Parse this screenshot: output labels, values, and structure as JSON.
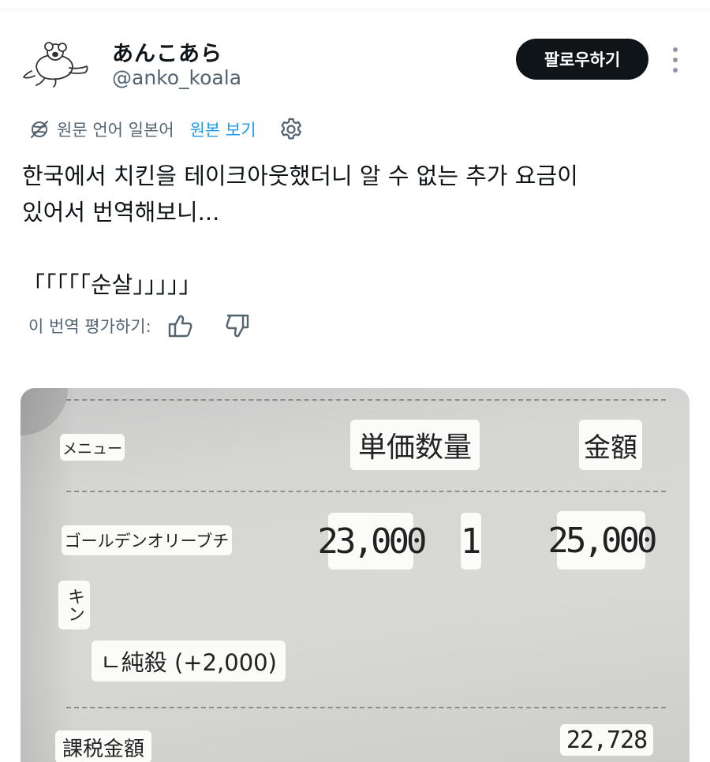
{
  "user": {
    "display_name": "あんこあら",
    "handle": "@anko_koala",
    "follow_label": "팔로우하기"
  },
  "translation": {
    "original_language": "원문 언어 일본어",
    "show_original": "원본 보기"
  },
  "tweet": {
    "lines": [
      "한국에서 치킨을 테이크아웃했더니 알 수 없는 추가 요금이",
      "있어서 번역해보니...",
      "「「「「「순살」」」」」"
    ]
  },
  "rate": {
    "label": "이 번역 평가하기:"
  },
  "receipt": {
    "menu_header": "メニュー",
    "unit_qty_header": "単価数量",
    "amount_header": "金額",
    "item_name": "ゴールデンオリーブチ",
    "item_name_cont": "キン",
    "unit_price": "23,000",
    "quantity": "1",
    "amount": "25,000",
    "option": "ㄴ純殺 (+2,000)",
    "taxable_label": "課税金額",
    "taxable_amount": "22,728"
  },
  "icons": {
    "avatar": "koala-avatar",
    "more": "more-vertical-icon",
    "globe": "globe-icon",
    "settings": "gear-icon",
    "like": "thumbs-up-icon",
    "dislike": "thumbs-down-icon"
  },
  "colors": {
    "text": "#0f1419",
    "muted": "#536471",
    "accent": "#1d9bf0",
    "button_bg": "#0f1419"
  }
}
